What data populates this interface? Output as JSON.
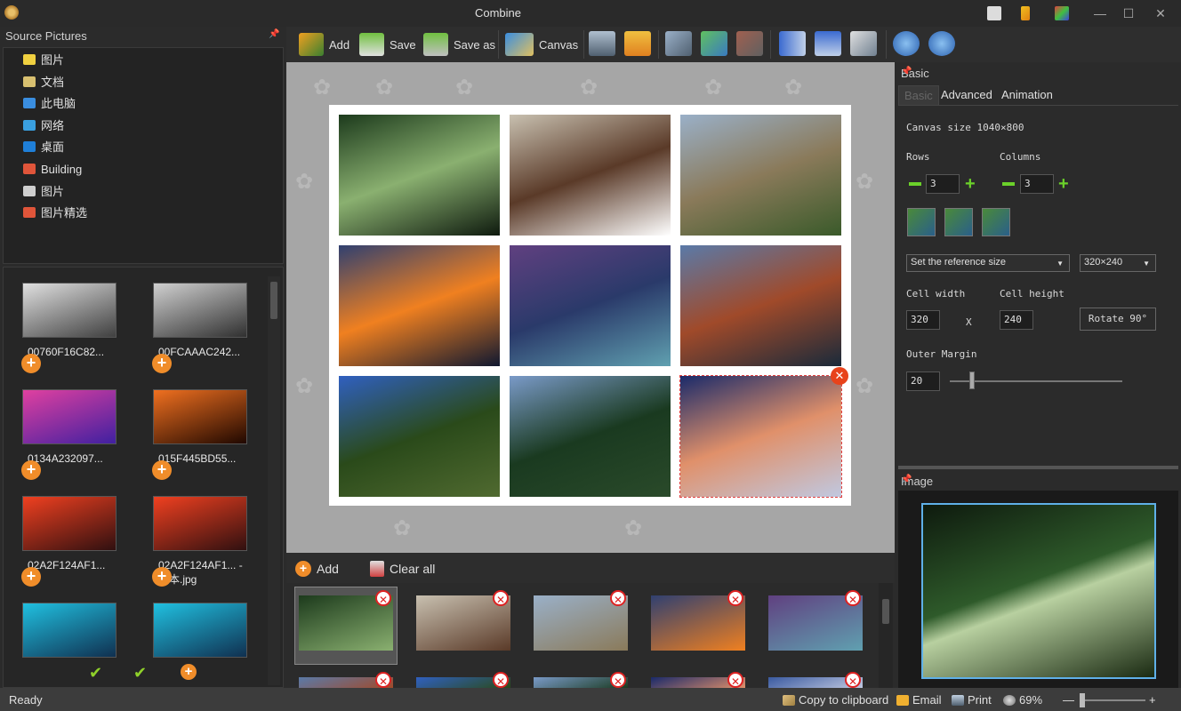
{
  "window": {
    "title": "Combine",
    "controls": [
      "—",
      "☐",
      "✕"
    ]
  },
  "source_panel": {
    "title": "Source Pictures",
    "tree": [
      {
        "label": "图片",
        "icon": "pictures-folder-icon",
        "color": "#f0d040"
      },
      {
        "label": "文档",
        "icon": "documents-folder-icon",
        "color": "#d8c070"
      },
      {
        "label": "此电脑",
        "icon": "computer-icon",
        "color": "#3a8ee0"
      },
      {
        "label": "网络",
        "icon": "network-icon",
        "color": "#3aa0e0"
      },
      {
        "label": "桌面",
        "icon": "desktop-icon",
        "color": "#1f7fd8"
      },
      {
        "label": "Building",
        "icon": "heart-folder-icon",
        "color": "#e0553a"
      },
      {
        "label": "图片",
        "icon": "cat-folder-icon",
        "color": "#cfcfcf"
      },
      {
        "label": "图片精选",
        "icon": "heart-folder-icon",
        "color": "#e0553a"
      }
    ],
    "thumbnails": [
      {
        "caption": "00760F16C82...",
        "colors": [
          "#e0e0e0",
          "#404040"
        ]
      },
      {
        "caption": "00FCAAAC242...",
        "colors": [
          "#d0d0d0",
          "#303030"
        ]
      },
      {
        "caption": "0134A232097...",
        "colors": [
          "#e040a0",
          "#4020a0"
        ]
      },
      {
        "caption": "015F445BD55...",
        "colors": [
          "#f07020",
          "#200800"
        ]
      },
      {
        "caption": "02A2F124AF1...",
        "colors": [
          "#f04020",
          "#301010"
        ]
      },
      {
        "caption": "02A2F124AF1... - 副本.jpg",
        "colors": [
          "#f04020",
          "#301010"
        ]
      },
      {
        "caption": "",
        "colors": [
          "#20c0e0",
          "#103050"
        ]
      },
      {
        "caption": "",
        "colors": [
          "#20c0e0",
          "#103050"
        ]
      }
    ]
  },
  "toolbar": {
    "add": "Add",
    "save": "Save",
    "save_as": "Save as",
    "canvas": "Canvas"
  },
  "collage": {
    "cells": [
      {
        "colors": [
          "#1c3a1c",
          "#8ab070",
          "#0e1a0e"
        ]
      },
      {
        "colors": [
          "#c8c0b0",
          "#5a3a28",
          "#ffffff"
        ]
      },
      {
        "colors": [
          "#9ab0c8",
          "#8a7a5a",
          "#3a5a2a"
        ]
      },
      {
        "colors": [
          "#304070",
          "#f08020",
          "#101830"
        ]
      },
      {
        "colors": [
          "#604080",
          "#2a3a6a",
          "#60a0b0"
        ]
      },
      {
        "colors": [
          "#5a7aa8",
          "#a04a2a",
          "#1a2a3a"
        ]
      },
      {
        "colors": [
          "#3060c0",
          "#2a4a1a",
          "#506a30"
        ]
      },
      {
        "colors": [
          "#7a9ac8",
          "#1a3a20",
          "#2a4a2a"
        ]
      },
      {
        "colors": [
          "#1a2a6a",
          "#e0906a",
          "#c0c8e0"
        ]
      }
    ]
  },
  "list_toolbar": {
    "add": "Add",
    "clear_all": "Clear all"
  },
  "list_items": [
    {
      "colors": [
        "#1c3a1c",
        "#8ab070"
      ]
    },
    {
      "colors": [
        "#c8c0b0",
        "#5a3a28"
      ]
    },
    {
      "colors": [
        "#9ab0c8",
        "#8a7a5a"
      ]
    },
    {
      "colors": [
        "#304070",
        "#f08020"
      ]
    },
    {
      "colors": [
        "#604080",
        "#60a0b0"
      ]
    },
    {
      "colors": [
        "#5a7aa8",
        "#a04a2a"
      ]
    },
    {
      "colors": [
        "#3060c0",
        "#2a4a1a"
      ]
    },
    {
      "colors": [
        "#7a9ac8",
        "#1a3a20"
      ]
    },
    {
      "colors": [
        "#1a2a6a",
        "#e0906a"
      ]
    },
    {
      "colors": [
        "#3a5aa0",
        "#c0c8e0"
      ]
    }
  ],
  "basic_panel": {
    "title": "Basic",
    "tabs": [
      "Basic",
      "Advanced",
      "Animation"
    ],
    "canvas_size": "Canvas size 1040×800",
    "rows_label": "Rows",
    "rows_value": "3",
    "columns_label": "Columns",
    "columns_value": "3",
    "reference_select": "Set the reference size",
    "size_select": "320×240",
    "cell_width_label": "Cell width",
    "cell_height_label": "Cell height",
    "cell_width_value": "320",
    "x_sep": "X",
    "cell_height_value": "240",
    "rotate_button": "Rotate 90°",
    "outer_margin_label": "Outer Margin",
    "outer_margin_value": "20"
  },
  "image_panel": {
    "title": "Image"
  },
  "status": {
    "ready": "Ready",
    "copy": "Copy to clipboard",
    "email": "Email",
    "print": "Print",
    "zoom": "69%",
    "zoom_minus": "—",
    "zoom_plus": "+"
  },
  "colors": {
    "accent_orange": "#f08d2a",
    "delete_red": "#e8431b",
    "add_green": "#6bd12a"
  }
}
